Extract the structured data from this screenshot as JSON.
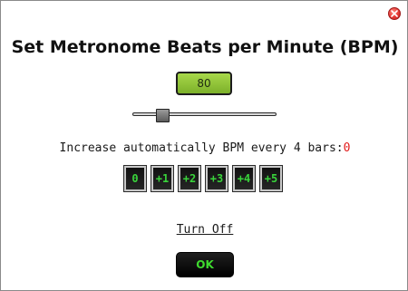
{
  "dialog": {
    "title": "Set Metronome Beats per Minute (BPM)",
    "close_icon": "close-icon"
  },
  "bpm": {
    "value": "80",
    "slider_fraction": 0.18
  },
  "auto_increase": {
    "label": "Increase automatically BPM every 4 bars:",
    "value": "0",
    "value_color": "#e21b1b",
    "options": [
      "0",
      "+1",
      "+2",
      "+3",
      "+4",
      "+5"
    ]
  },
  "turn_off_label": "Turn Off",
  "ok_label": "OK",
  "colors": {
    "accent_green": "#39d43b",
    "display_green": "#8fc43a",
    "button_dark": "#111111"
  }
}
